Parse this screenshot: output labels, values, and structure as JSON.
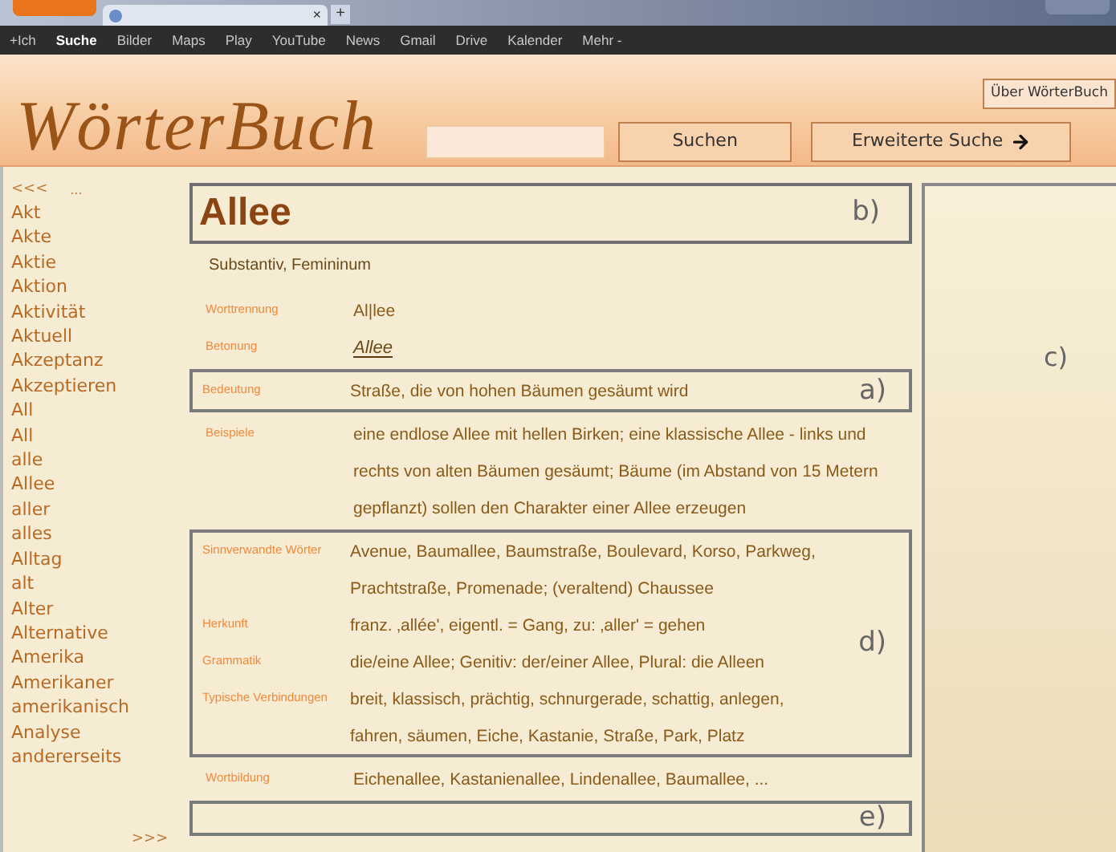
{
  "browser": {
    "tab_close": "×",
    "new_tab": "+"
  },
  "google_bar": [
    {
      "label": "+Ich",
      "selected": false
    },
    {
      "label": "Suche",
      "selected": true
    },
    {
      "label": "Bilder",
      "selected": false
    },
    {
      "label": "Maps",
      "selected": false
    },
    {
      "label": "Play",
      "selected": false
    },
    {
      "label": "YouTube",
      "selected": false
    },
    {
      "label": "News",
      "selected": false
    },
    {
      "label": "Gmail",
      "selected": false
    },
    {
      "label": "Drive",
      "selected": false
    },
    {
      "label": "Kalender",
      "selected": false
    },
    {
      "label": "Mehr -",
      "selected": false
    }
  ],
  "header": {
    "logo": "WörterBuch",
    "about_button": "Über WörterBuch",
    "search_button": "Suchen",
    "advanced_search_button": "Erweiterte Suche"
  },
  "word_list": {
    "prev": "<<<",
    "ellipsis": "...",
    "next": ">>>",
    "items": [
      "Akt",
      "Akte",
      "Aktie",
      "Aktion",
      "Aktivität",
      "Aktuell",
      "Akzeptanz",
      "Akzeptieren",
      "All",
      "All",
      "alle",
      "Allee",
      "aller",
      "alles",
      "Alltag",
      "alt",
      "Alter",
      "Alternative",
      "Amerika",
      "Amerikaner",
      "amerikanisch",
      "Analyse",
      "andererseits"
    ]
  },
  "entry": {
    "headword": "Allee",
    "marker": "b)",
    "word_class": "Substantiv, Femininum",
    "groups": [
      {
        "rows": [
          {
            "label": "Worttrennung",
            "value": "Al|lee",
            "kind": "plain"
          },
          {
            "label": "Betonung",
            "value": "Allee",
            "kind": "stress"
          }
        ]
      },
      {
        "marker": "a)",
        "rows": [
          {
            "label": "Bedeutung",
            "value": "Straße, die von hohen Bäumen gesäumt wird",
            "kind": "plain"
          }
        ]
      },
      {
        "rows": [
          {
            "label": "Beispiele",
            "value": "eine endlose Allee mit hellen Birken; eine klassische Allee - links und rechts von alten Bäumen gesäumt; Bäume (im Abstand von 15 Metern gepflanzt) sollen den Charakter einer Allee erzeugen",
            "kind": "plain"
          }
        ]
      },
      {
        "marker": "d)",
        "rows": [
          {
            "label": "Sinnverwandte Wörter",
            "value": "Avenue, Baumallee, Baumstraße, Boulevard, Korso, Parkweg, Prachtstraße, Promenade; (veraltend) Chaussee",
            "kind": "plain"
          },
          {
            "label": "Herkunft",
            "value": "franz. ‚allée', eigentl. = Gang, zu: ‚aller' = gehen",
            "kind": "plain"
          },
          {
            "label": "Grammatik",
            "value": "die/eine Allee; Genitiv: der/einer Allee, Plural: die Alleen",
            "kind": "plain"
          },
          {
            "label": "Typische Verbindungen",
            "value": "breit, klassisch, prächtig, schnurgerade, schattig, anlegen, fahren, säumen, Eiche, Kastanie, Straße, Park, Platz",
            "kind": "plain"
          }
        ]
      },
      {
        "rows": [
          {
            "label": "Wortbildung",
            "value": "Eichenallee, Kastanienallee, Lindenallee, Baumallee, ...",
            "kind": "plain"
          }
        ]
      },
      {
        "marker": "e)"
      }
    ]
  },
  "side_panel": {
    "marker": "c)"
  }
}
